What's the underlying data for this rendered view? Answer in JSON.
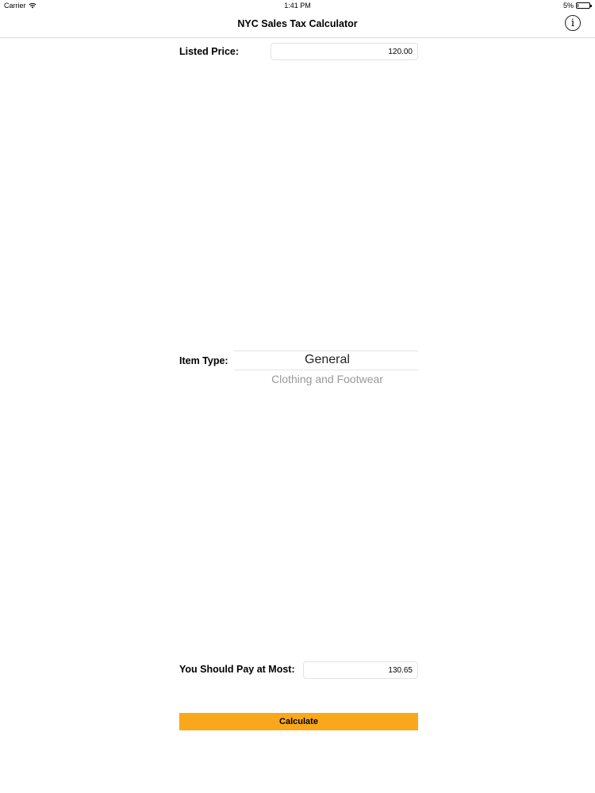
{
  "status_bar": {
    "carrier": "Carrier",
    "time": "1:41 PM",
    "battery_percent": "5%",
    "battery_level": 0.05
  },
  "nav": {
    "title": "NYC Sales Tax Calculator",
    "info_icon": "info-icon",
    "info_glyph": "i"
  },
  "form": {
    "listed_price_label": "Listed Price:",
    "listed_price_value": "120.00",
    "item_type_label": "Item Type:",
    "item_type_options": [
      "General",
      "Clothing and Footwear"
    ],
    "item_type_selected": "General",
    "pay_at_most_label": "You Should Pay at Most:",
    "pay_at_most_value": "130.65",
    "calculate_label": "Calculate"
  },
  "colors": {
    "accent": "#f9a71b"
  }
}
